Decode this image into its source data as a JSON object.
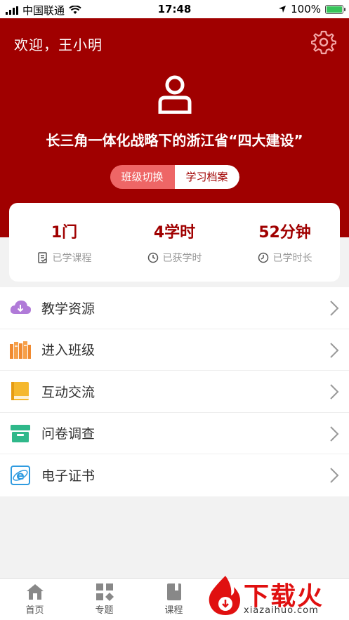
{
  "status_bar": {
    "carrier": "中国联通",
    "time": "17:48",
    "battery": "100%",
    "battery_level": 1.0
  },
  "header": {
    "welcome": "欢迎，王小明",
    "course_title": "长三角一体化战略下的浙江省“四大建设”",
    "toggle": {
      "inactive_label": "班级切换",
      "active_label": "学习档案"
    }
  },
  "stats": [
    {
      "value": "1门",
      "label": "已学课程",
      "icon": "course-list-icon"
    },
    {
      "value": "4学时",
      "label": "已获学时",
      "icon": "hours-icon"
    },
    {
      "value": "52分钟",
      "label": "已学时长",
      "icon": "clock-icon"
    }
  ],
  "menu": [
    {
      "label": "教学资源",
      "icon": "cloud-download-icon",
      "color": "#b07ad8"
    },
    {
      "label": "进入班级",
      "icon": "books-icon",
      "color": "#f08a30"
    },
    {
      "label": "互动交流",
      "icon": "book-icon",
      "color": "#f5b82e"
    },
    {
      "label": "问卷调查",
      "icon": "archive-box-icon",
      "color": "#2fb88a"
    },
    {
      "label": "电子证书",
      "icon": "browser-e-icon",
      "color": "#2f9be0"
    }
  ],
  "bottom_nav": [
    {
      "label": "首页",
      "icon": "home-icon"
    },
    {
      "label": "专题",
      "icon": "topics-grid-icon"
    },
    {
      "label": "课程",
      "icon": "course-book-icon"
    }
  ],
  "watermark": {
    "text": "下载火",
    "url": "xiazaihuo.com"
  },
  "colors": {
    "brand": "#a00000",
    "toggle_inactive": "#ee6666"
  }
}
